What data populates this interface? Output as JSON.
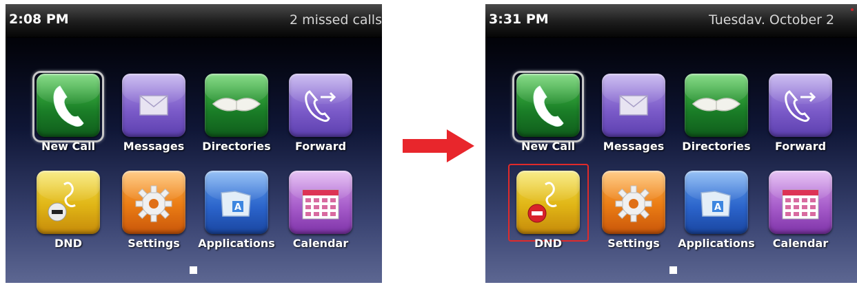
{
  "screens": [
    {
      "status_bar": {
        "time": "2:08 PM",
        "right_text": "2 missed calls"
      },
      "selected_app": "New Call",
      "highlighted_app": null
    },
    {
      "status_bar": {
        "time": "3:31 PM",
        "right_text": "Tuesdav. October 2"
      },
      "selected_app": "New Call",
      "highlighted_app": "DND"
    }
  ],
  "apps": [
    {
      "label": "New Call",
      "icon": "phone-handset-icon",
      "color": "#2ea535"
    },
    {
      "label": "Messages",
      "icon": "envelope-icon",
      "color": "#8b6ad5"
    },
    {
      "label": "Directories",
      "icon": "open-book-icon",
      "color": "#2ea535"
    },
    {
      "label": "Forward",
      "icon": "phone-forward-icon",
      "color": "#8b6ad5"
    },
    {
      "label": "DND",
      "icon": "do-not-disturb-icon",
      "color": "#e3b51a"
    },
    {
      "label": "Settings",
      "icon": "gear-icon",
      "color": "#ee8418"
    },
    {
      "label": "Applications",
      "icon": "folder-icon",
      "color": "#2f6fd6"
    },
    {
      "label": "Calendar",
      "icon": "calendar-icon",
      "color": "#b266d6"
    }
  ],
  "highlight_color": "#e02a2a",
  "arrow_color": "#e8262c",
  "page_indicator": {
    "current": 1
  }
}
